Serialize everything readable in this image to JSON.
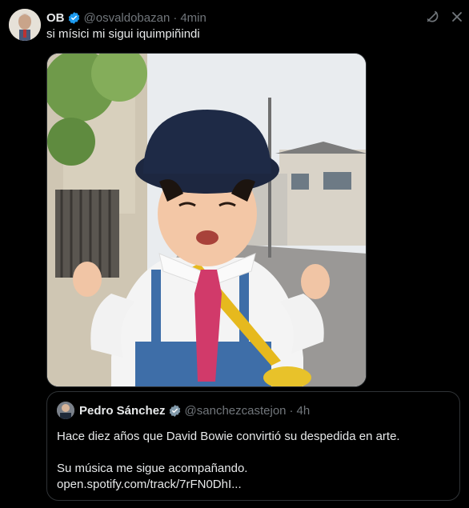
{
  "tweet": {
    "author_name": "OB",
    "handle": "@osvaldobazan",
    "separator": "·",
    "time": "4min",
    "text": "si mísici mi sigui iquimpiñindi"
  },
  "quote": {
    "author_name": "Pedro Sánchez",
    "handle": "@sanchezcastejon",
    "separator": "·",
    "time": "4h",
    "line1": "Hace diez años que David Bowie convirtió su despedida en arte.",
    "line2": "Su música me sigue acompañando.",
    "line3": "open.spotify.com/track/7rFN0DhI..."
  },
  "icons": {
    "verified": "verified-badge-icon",
    "grok": "grok-icon",
    "menu": "more-menu-icon"
  },
  "colors": {
    "background": "#000000",
    "text": "#e7e9ea",
    "muted": "#71767b",
    "verified": "#1d9bf0",
    "border": "#2f3336"
  }
}
